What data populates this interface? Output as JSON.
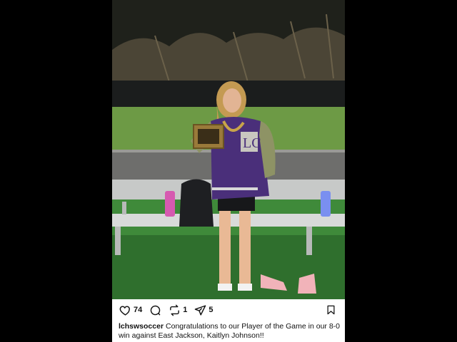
{
  "post": {
    "likes": "74",
    "reposts": "1",
    "shares": "5",
    "username": "lchswsoccer",
    "caption": "Congratulations to our Player of the Game in our 8-0 win against East Jackson, Kaitlyn Johnson!!"
  },
  "icons": {
    "like": "heart-icon",
    "comment": "comment-icon",
    "repost": "repost-icon",
    "share": "send-icon",
    "save": "bookmark-icon"
  },
  "colors": {
    "letterman_jacket": "#4a2f7a",
    "field": "#3f8a3a",
    "text": "#111111"
  }
}
